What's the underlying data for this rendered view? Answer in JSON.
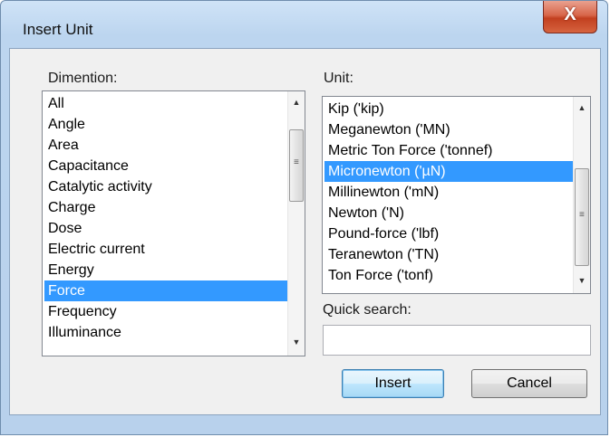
{
  "window": {
    "title": "Insert Unit",
    "close_glyph": "X"
  },
  "dimension": {
    "label": "Dimention:",
    "items": [
      "All",
      "Angle",
      "Area",
      "Capacitance",
      "Catalytic activity",
      "Charge",
      "Dose",
      "Electric current",
      "Energy",
      "Force",
      "Frequency",
      "Illuminance"
    ],
    "selected": "Force"
  },
  "unit": {
    "label": "Unit:",
    "items": [
      "Kip ('kip)",
      "Meganewton ('MN)",
      "Metric Ton Force ('tonnef)",
      "Micronewton ('µN)",
      "Millinewton ('mN)",
      "Newton ('N)",
      "Pound-force ('lbf)",
      "Teranewton ('TN)",
      "Ton Force ('tonf)"
    ],
    "selected": "Micronewton ('µN)"
  },
  "search": {
    "label": "Quick search:",
    "value": ""
  },
  "buttons": {
    "insert": "Insert",
    "cancel": "Cancel"
  },
  "icons": {
    "close": "close-icon",
    "scroll_up": "arrow-up-icon",
    "scroll_down": "arrow-down-icon",
    "grip": "scroll-grip-icon"
  }
}
